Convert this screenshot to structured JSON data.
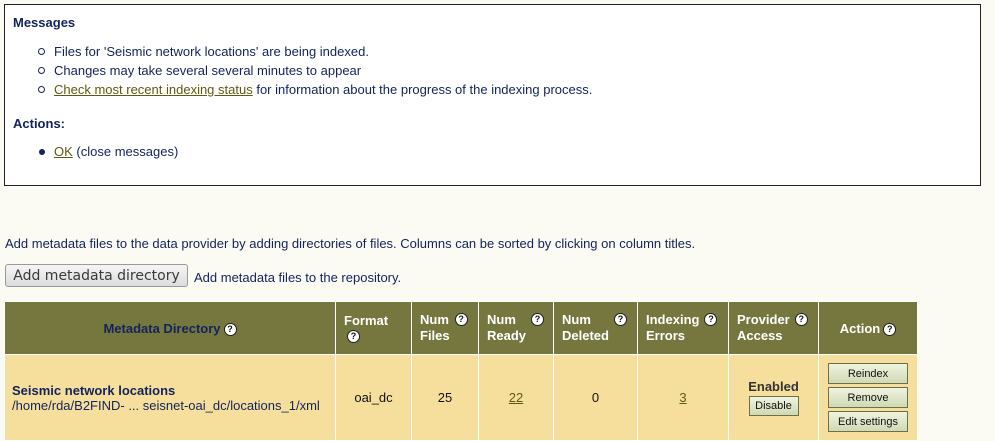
{
  "messages": {
    "heading": "Messages",
    "items": [
      "Files for 'Seismic network locations' are being indexed.",
      "Changes may take several several minutes to appear"
    ],
    "status_link": "Check most recent indexing status",
    "status_suffix": " for information about the progress of the indexing process.",
    "actions_heading": "Actions:",
    "ok_link": "OK",
    "ok_suffix": " (close messages)"
  },
  "intro_text": "Add metadata files to the data provider by adding directories of files. Columns can be sorted by clicking on column titles.",
  "add_button_label": "Add metadata directory",
  "add_note": "Add metadata files to the repository.",
  "table": {
    "headers": {
      "directory": "Metadata Directory",
      "format": "Format",
      "num_files_1": "Num",
      "num_files_2": "Files",
      "num_ready_1": "Num",
      "num_ready_2": "Ready",
      "num_deleted_1": "Num",
      "num_deleted_2": "Deleted",
      "errors_1": "Indexing",
      "errors_2": "Errors",
      "access_1": "Provider",
      "access_2": "Access",
      "action": "Action"
    },
    "help_glyph": "?",
    "rows": [
      {
        "name": "Seismic network locations",
        "path": "/home/rda/B2FIND- ... seisnet-oai_dc/locations_1/xml",
        "format": "oai_dc",
        "num_files": "25",
        "num_ready": "22",
        "num_deleted": "0",
        "errors": "3",
        "access_status": "Enabled",
        "access_button": "Disable",
        "actions": [
          "Reindex",
          "Remove",
          "Edit settings"
        ]
      }
    ]
  },
  "colors": {
    "header_bg": "#76773f",
    "row_bg": "#f6df9d",
    "text": "#13235b",
    "link": "#5f5a10",
    "page_bg": "#fbfaf3"
  },
  "icons": {
    "help": "help-icon",
    "bullet_circle": "circle-bullet-icon",
    "bullet_disc": "disc-bullet-icon"
  }
}
